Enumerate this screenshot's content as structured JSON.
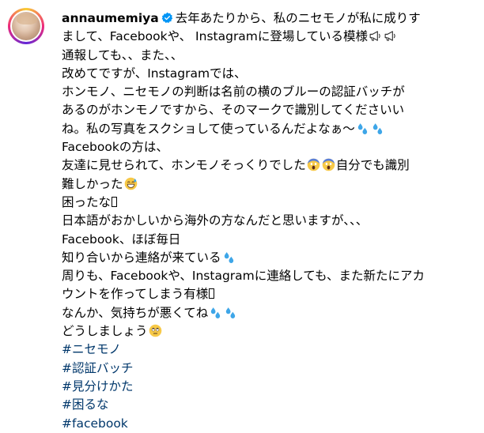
{
  "post": {
    "username": "annaumemiya",
    "lines": [
      "去年あたりから、私のニセモノが私に成りす",
      "まして、Facebookや、 Instagramに登場している模様",
      "通報しても、、また、、",
      "改めてですが、Instagramでは、",
      "ホンモノ、ニセモノの判断は名前の横のブルーの認証バッチが",
      "あるのがホンモノですから、そのマークで識別してくださいい",
      "ね。私の写真をスクショして使っているんだよなぁ〜",
      "Facebookの方は、",
      "友達に見せられて、ホンモノそっくりでした",
      "自分でも識別",
      "難しかった",
      "困ったな",
      "日本語がおかしいから海外の方なんだと思いますが、、、",
      "Facebook、ほぼ毎日",
      "知り合いから連絡が来ている",
      "周りも、Facebookや、Instagramに連絡しても、また新たにアカ",
      "ウントを作ってしまう有様",
      "なんか、気持ちが悪くてね",
      "どうしましょう"
    ],
    "hashtags": [
      "#ニセモノ",
      "#認証バッチ",
      "#見分けかた",
      "#困るな",
      "#facebook"
    ]
  },
  "colors": {
    "hashtag": "#00376b",
    "verified": "#0095f6",
    "emoji_sweat": "#3ea6e8",
    "emoji_face": "#f7c948"
  },
  "icons": {
    "verified": "verified-badge-icon",
    "megaphone": "megaphone-icon",
    "sweat": "sweat-droplets-icon",
    "scream": "screaming-face-icon",
    "grin_sweat": "grinning-sweat-face-icon",
    "eyeroll": "face-with-rolling-eyes-icon"
  }
}
